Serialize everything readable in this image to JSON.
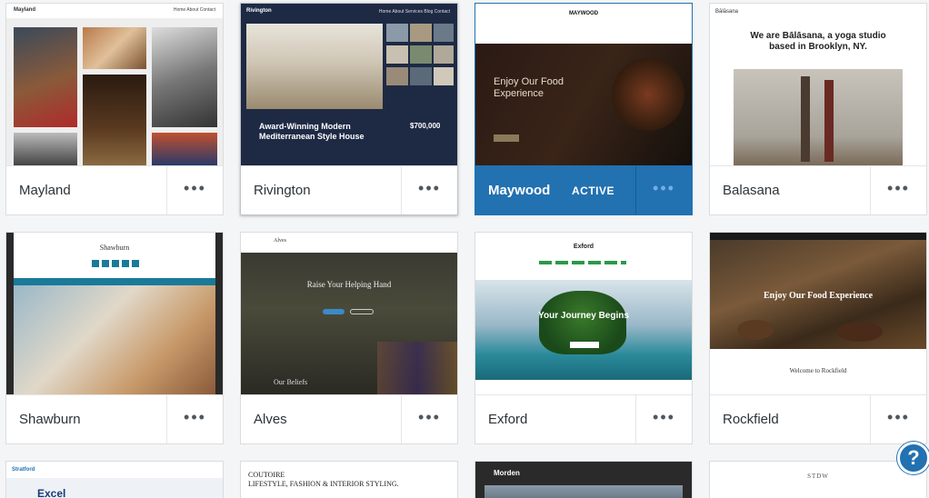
{
  "more_label": "•••",
  "active_label": "ACTIVE",
  "help_label": "?",
  "themes": [
    {
      "name": "Mayland",
      "site": "Mayland",
      "nav": "Home  About  Contact"
    },
    {
      "name": "Rivington",
      "site": "Rivington",
      "nav": "Home  About  Services  Blog  Contact",
      "headline": "Award-Winning Modern Mediterranean Style House",
      "price": "$700,000"
    },
    {
      "name": "Maywood",
      "site": "MAYWOOD",
      "headline": "Enjoy Our Food Experience"
    },
    {
      "name": "Balasana",
      "site": "Bālāsana",
      "headline": "We are Bālāsana, a yoga studio based in Brooklyn, NY."
    },
    {
      "name": "Shawburn",
      "site": "Shawburn"
    },
    {
      "name": "Alves",
      "site": "Alves",
      "headline": "Raise Your Helping Hand",
      "sub": "Our Beliefs"
    },
    {
      "name": "Exford",
      "site": "Exford",
      "headline": "Your Journey Begins"
    },
    {
      "name": "Rockfield",
      "site": "Rockfield",
      "headline": "Enjoy Our Food Experience",
      "sub": "Welcome to Rockfield"
    },
    {
      "site": "Stratford",
      "headline": "Excel"
    },
    {
      "site": "COUTOIRE",
      "headline": "LIFESTYLE, FASHION & INTERIOR STYLING."
    },
    {
      "site": "Morden"
    },
    {
      "site": "STDW"
    }
  ]
}
